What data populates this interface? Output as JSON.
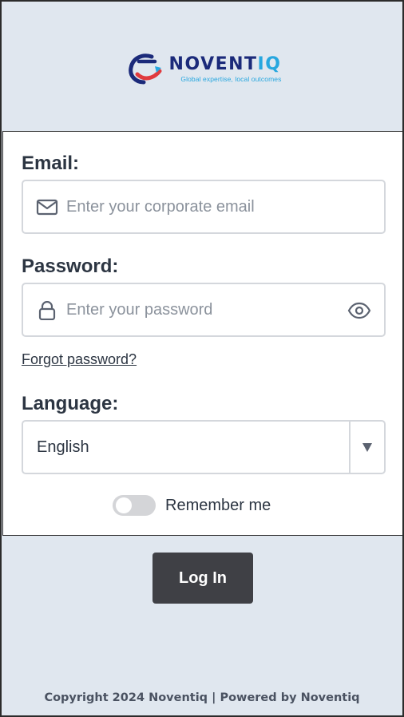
{
  "brand": {
    "name_main": "NOVENT",
    "name_accent": "IQ",
    "tagline": "Global expertise, local outcomes"
  },
  "form": {
    "email_label": "Email:",
    "email_placeholder": "Enter your corporate email",
    "email_value": "",
    "password_label": "Password:",
    "password_placeholder": "Enter your password",
    "password_value": "",
    "forgot_link": "Forgot password?",
    "language_label": "Language:",
    "language_selected": "English",
    "remember_label": "Remember me",
    "remember_checked": false
  },
  "actions": {
    "login_label": "Log In"
  },
  "footer": {
    "text": "Copyright 2024 Noventiq | Powered by Noventiq"
  },
  "icons": {
    "email": "mail-icon",
    "password": "lock-icon",
    "reveal": "eye-icon",
    "dropdown": "caret-down-icon"
  },
  "colors": {
    "background": "#e0e7ef",
    "brand_navy": "#1b2a7a",
    "brand_cyan": "#27a7df",
    "brand_red": "#e03a3e",
    "button": "#3f4045",
    "text": "#2c3542"
  }
}
